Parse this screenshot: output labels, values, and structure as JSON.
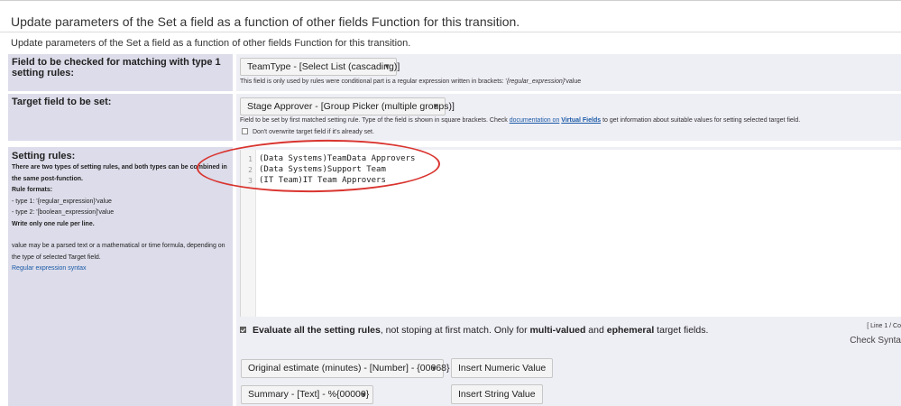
{
  "header": {
    "title": "Update parameters of the Set a field as a function of other fields Function for this transition.",
    "description": "Update parameters of the Set a field as a function of other fields Function for this transition."
  },
  "matching_field": {
    "label": "Field to be checked for matching with type 1 setting rules:",
    "selected": "TeamType - [Select List (cascading)]",
    "hint_prefix": "This field is only used by rules were conditional part is a regular expression written in brackets: '",
    "hint_italic": "{regular_expression}",
    "hint_suffix": "'value"
  },
  "target_field": {
    "label": "Target field to be set:",
    "selected": "Stage Approver - [Group Picker (multiple groups)]",
    "hint_prefix": "Field to be set by first matched setting rule. Type of the field is shown in square brackets. Check ",
    "hint_link1": "documentation on",
    "hint_link2": "Virtual Fields",
    "hint_suffix": " to get information about suitable values for setting selected target field.",
    "dont_overwrite_label": "Don't overwrite target field if it's already set."
  },
  "setting_rules": {
    "label": "Setting rules:",
    "help_line1": "There are two types of setting rules, and both types can be combined in",
    "help_line2": "the same post-function.",
    "formats_title": "Rule formats:",
    "type1": " - type 1: '{regular_expression}'value",
    "type2": " - type 2: '[boolean_expression]'value",
    "one_rule": "Write only one rule per line.",
    "value_note1": "value may be a parsed text or a mathematical or time formula, depending on",
    "value_note2": "the type of selected Target field.",
    "syntax_link": "Regular expression syntax",
    "lines": [
      {
        "num": "1",
        "text": "(Data Systems)TeamData Approvers"
      },
      {
        "num": "2",
        "text": "(Data Systems)Support Team"
      },
      {
        "num": "3",
        "text": "(IT Team)IT Team Approvers"
      }
    ]
  },
  "evaluate": {
    "label_bold1": "Evaluate all the setting rules",
    "label_mid": ", not stoping at first match. Only for ",
    "label_bold2": "multi-valued",
    "label_and": " and ",
    "label_bold3": "ephemeral",
    "label_end": " target fields.",
    "position": "[ Line 1 / Co",
    "check_syntax": "Check Synta"
  },
  "inserts": {
    "numeric_select": "Original estimate (minutes) - [Number] - {00068}",
    "numeric_button": "Insert Numeric Value",
    "string_select": "Summary - [Text] - %{00000}",
    "string_button": "Insert String Value"
  },
  "colors": {
    "label_bg": "#dcdcea",
    "value_bg": "#eeeef5",
    "link": "#1a5aa6",
    "annotation": "#d9342f"
  }
}
